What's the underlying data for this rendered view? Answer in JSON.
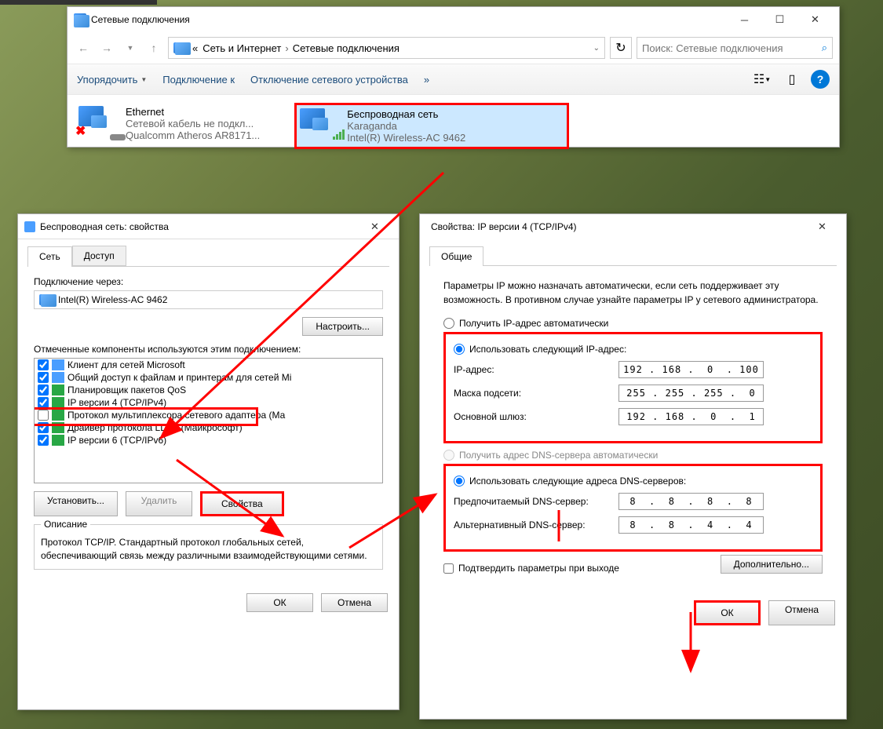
{
  "main_window": {
    "title": "Сетевые подключения",
    "breadcrumb": {
      "prefix": "«",
      "part1": "Сеть и Интернет",
      "part2": "Сетевые подключения"
    },
    "search_placeholder": "Поиск: Сетевые подключения",
    "toolbar": {
      "organize": "Упорядочить",
      "connect": "Подключение к",
      "disable": "Отключение сетевого устройства",
      "more": "»"
    },
    "connections": {
      "ethernet": {
        "name": "Ethernet",
        "status": "Сетевой кабель не подкл...",
        "adapter": "Qualcomm Atheros AR8171..."
      },
      "wifi": {
        "name": "Беспроводная сеть",
        "network": "Karaganda",
        "adapter": "Intel(R) Wireless-AC 9462"
      }
    }
  },
  "dlg_props": {
    "title": "Беспроводная сеть: свойства",
    "tab_network": "Сеть",
    "tab_access": "Доступ",
    "connect_via": "Подключение через:",
    "adapter": "Intel(R) Wireless-AC 9462",
    "configure": "Настроить...",
    "components_label": "Отмеченные компоненты используются этим подключением:",
    "components": [
      "Клиент для сетей Microsoft",
      "Общий доступ к файлам и принтерам для сетей Mi",
      "Планировщик пакетов QoS",
      "IP версии 4 (TCP/IPv4)",
      "Протокол мультиплексора сетевого адаптера (Ма",
      "Драйвер протокола LLDP (Майкрософт)",
      "IP версии 6 (TCP/IPv6)"
    ],
    "install": "Установить...",
    "uninstall": "Удалить",
    "properties": "Свойства",
    "desc_title": "Описание",
    "desc_text": "Протокол TCP/IP. Стандартный протокол глобальных сетей, обеспечивающий связь между различными взаимодействующими сетями.",
    "ok": "ОК",
    "cancel": "Отмена"
  },
  "dlg_ipv4": {
    "title": "Свойства: IP версии 4 (TCP/IPv4)",
    "tab_general": "Общие",
    "intro": "Параметры IP можно назначать автоматически, если сеть поддерживает эту возможность. В противном случае узнайте параметры IP у сетевого администратора.",
    "auto_ip": "Получить IP-адрес автоматически",
    "use_ip": "Использовать следующий IP-адрес:",
    "ip_label": "IP-адрес:",
    "ip_value": "192 . 168 .  0  . 100",
    "mask_label": "Маска подсети:",
    "mask_value": "255 . 255 . 255 .  0",
    "gateway_label": "Основной шлюз:",
    "gateway_value": "192 . 168 .  0  .  1",
    "auto_dns": "Получить адрес DNS-сервера автоматически",
    "use_dns": "Использовать следующие адреса DNS-серверов:",
    "dns1_label": "Предпочитаемый DNS-сервер:",
    "dns1_value": "8  .  8  .  8  .  8",
    "dns2_label": "Альтернативный DNS-сервер:",
    "dns2_value": "8  .  8  .  4  .  4",
    "validate": "Подтвердить параметры при выходе",
    "advanced": "Дополнительно...",
    "ok": "ОК",
    "cancel": "Отмена"
  }
}
